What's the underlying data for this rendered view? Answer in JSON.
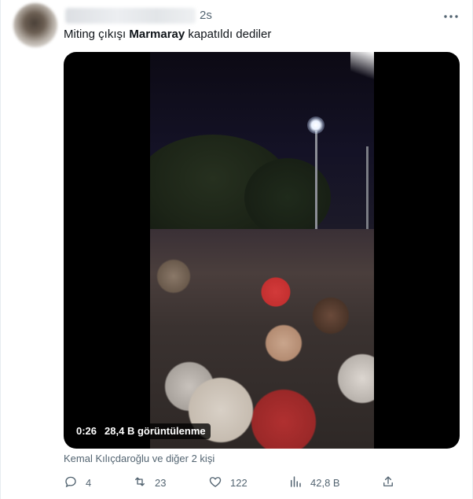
{
  "tweet": {
    "timestamp": "2s",
    "text_before": "Miting çıkışı ",
    "text_bold": "Marmaray",
    "text_after": " kapatıldı dediler"
  },
  "media": {
    "duration": "0:26",
    "views": "28,4 B görüntülenme"
  },
  "liked_by": "Kemal Kılıçdaroğlu ve diğer 2 kişi",
  "actions": {
    "reply_count": "4",
    "retweet_count": "23",
    "like_count": "122",
    "views_count": "42,8 B"
  },
  "icons": [
    "more-icon",
    "reply-icon",
    "retweet-icon",
    "like-icon",
    "views-icon",
    "share-icon"
  ],
  "colors": {
    "text": "#0f1419",
    "secondary": "#536471",
    "border": "#e6ecf0"
  }
}
